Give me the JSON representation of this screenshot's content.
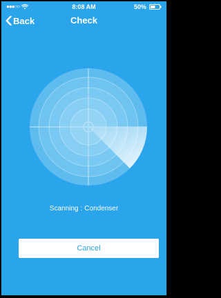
{
  "status_bar": {
    "time": "8:08 AM",
    "battery": "50%",
    "signal_icon": "signal-dots-icon",
    "wifi_icon": "wifi-icon",
    "battery_icon": "battery-icon"
  },
  "nav": {
    "back_label": "Back",
    "back_icon": "chevron-left-icon",
    "title": "Check"
  },
  "scan": {
    "label": "Scanning",
    "separator": ":",
    "target": "Condenser"
  },
  "cancel_button": {
    "label": "Cancel"
  },
  "colors": {
    "background": "#2aa4ea",
    "radar_ring": "#6fc4f1",
    "radar_center": "#8ed2f4",
    "sweep": "#ffffff",
    "button_bg": "#ffffff",
    "button_text": "#2aa4ea"
  }
}
